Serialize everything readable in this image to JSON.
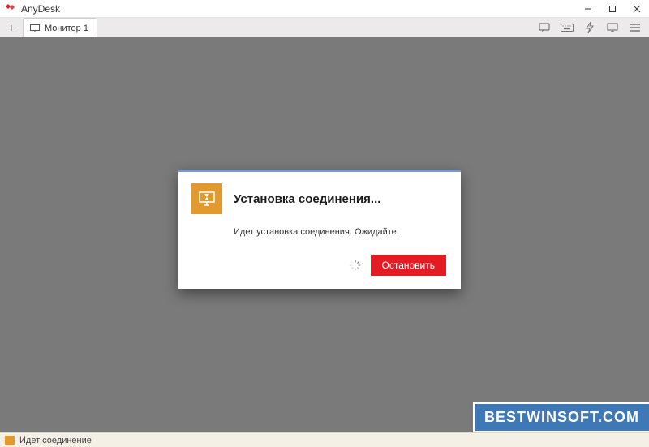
{
  "app": {
    "title": "AnyDesk"
  },
  "tabs": {
    "new_tab_label": "+",
    "items": [
      {
        "label": "Монитор 1"
      }
    ]
  },
  "toolbar": {
    "icons": [
      "chat",
      "keyboard",
      "lightning",
      "monitor",
      "menu"
    ]
  },
  "dialog": {
    "title": "Установка соединения...",
    "message": "Идет установка соединения. Ожидайте.",
    "stop_label": "Остановить"
  },
  "status": {
    "text": "Идет соединение"
  },
  "watermark": "BESTWINSOFT.COM"
}
